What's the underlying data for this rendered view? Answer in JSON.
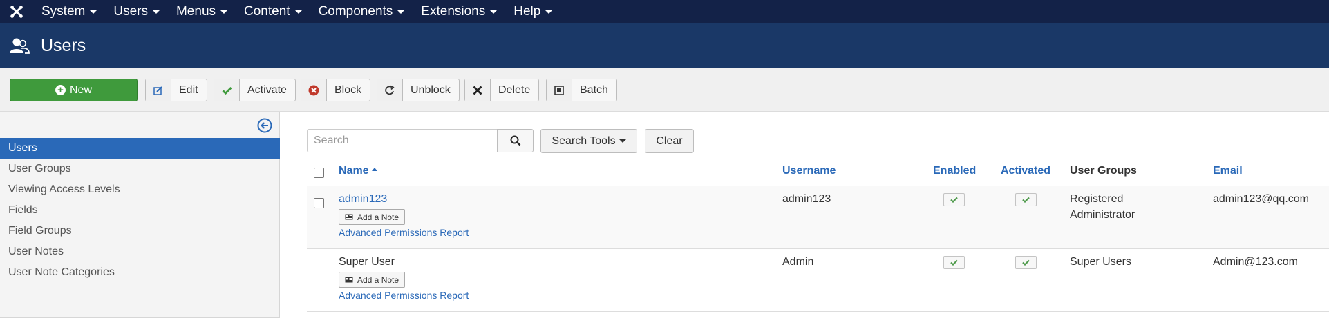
{
  "topnav": {
    "logo_icon": "joomla-logo-icon",
    "items": [
      {
        "label": "System"
      },
      {
        "label": "Users"
      },
      {
        "label": "Menus"
      },
      {
        "label": "Content"
      },
      {
        "label": "Components"
      },
      {
        "label": "Extensions"
      },
      {
        "label": "Help"
      }
    ]
  },
  "header": {
    "icon": "users-icon",
    "title": "Users"
  },
  "toolbar": {
    "new_label": "New",
    "edit_label": "Edit",
    "activate_label": "Activate",
    "block_label": "Block",
    "unblock_label": "Unblock",
    "delete_label": "Delete",
    "batch_label": "Batch"
  },
  "sidebar": {
    "toggle_icon": "collapse-left-icon",
    "items": [
      {
        "label": "Users",
        "active": true
      },
      {
        "label": "User Groups"
      },
      {
        "label": "Viewing Access Levels"
      },
      {
        "label": "Fields"
      },
      {
        "label": "Field Groups"
      },
      {
        "label": "User Notes"
      },
      {
        "label": "User Note Categories"
      }
    ]
  },
  "search": {
    "placeholder": "Search",
    "value": "",
    "tools_label": "Search Tools",
    "clear_label": "Clear"
  },
  "table": {
    "columns": {
      "name": "Name",
      "username": "Username",
      "enabled": "Enabled",
      "activated": "Activated",
      "groups": "User Groups",
      "email": "Email"
    },
    "rows": [
      {
        "name": "admin123",
        "note_label": "Add a Note",
        "permissions_label": "Advanced Permissions Report",
        "username": "admin123",
        "enabled": true,
        "activated": true,
        "groups_line1": "Registered",
        "groups_line2": "Administrator",
        "email": "admin123@qq.com"
      },
      {
        "name": "Super User",
        "note_label": "Add a Note",
        "permissions_label": "Advanced Permissions Report",
        "username": "Admin",
        "enabled": true,
        "activated": true,
        "groups_line1": "Super Users",
        "email": "Admin@123.com"
      }
    ]
  },
  "colors": {
    "topnav_bg": "#132248",
    "header_bg": "#1a3867",
    "new_button": "#3f9a3c",
    "link": "#2a69b8",
    "active_sidebar": "#2a69b8",
    "check_green": "#4e9a4b"
  }
}
